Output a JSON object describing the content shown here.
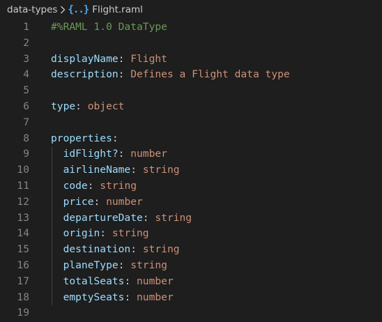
{
  "breadcrumb": {
    "folder": "data-types",
    "file": "Flight.raml",
    "file_icon": "curly-braces-icon"
  },
  "colors": {
    "background": "#1e1e1e",
    "line_number": "#858585",
    "key": "#9cdcfe",
    "string_value": "#ce9178",
    "comment": "#6a9955",
    "file_icon": "#4fa9f0"
  },
  "lines": [
    {
      "num": "1",
      "comment": "#%RAML 1.0 DataType"
    },
    {
      "num": "2"
    },
    {
      "num": "3",
      "key": "displayName",
      "colon": ":",
      "value": " Flight"
    },
    {
      "num": "4",
      "key": "description",
      "colon": ":",
      "value": " Defines a Flight data type"
    },
    {
      "num": "5"
    },
    {
      "num": "6",
      "key": "type",
      "colon": ":",
      "value": " object"
    },
    {
      "num": "7"
    },
    {
      "num": "8",
      "key": "properties",
      "colon": ":"
    },
    {
      "num": "9",
      "key": "  idFlight?",
      "colon": ":",
      "value": " number"
    },
    {
      "num": "10",
      "key": "  airlineName",
      "colon": ":",
      "value": " string"
    },
    {
      "num": "11",
      "key": "  code",
      "colon": ":",
      "value": " string"
    },
    {
      "num": "12",
      "key": "  price",
      "colon": ":",
      "value": " number"
    },
    {
      "num": "13",
      "key": "  departureDate",
      "colon": ":",
      "value": " string"
    },
    {
      "num": "14",
      "key": "  origin",
      "colon": ":",
      "value": " string"
    },
    {
      "num": "15",
      "key": "  destination",
      "colon": ":",
      "value": " string"
    },
    {
      "num": "16",
      "key": "  planeType",
      "colon": ":",
      "value": " string"
    },
    {
      "num": "17",
      "key": "  totalSeats",
      "colon": ":",
      "value": " number"
    },
    {
      "num": "18",
      "key": "  emptySeats",
      "colon": ":",
      "value": " number"
    },
    {
      "num": "19"
    }
  ]
}
